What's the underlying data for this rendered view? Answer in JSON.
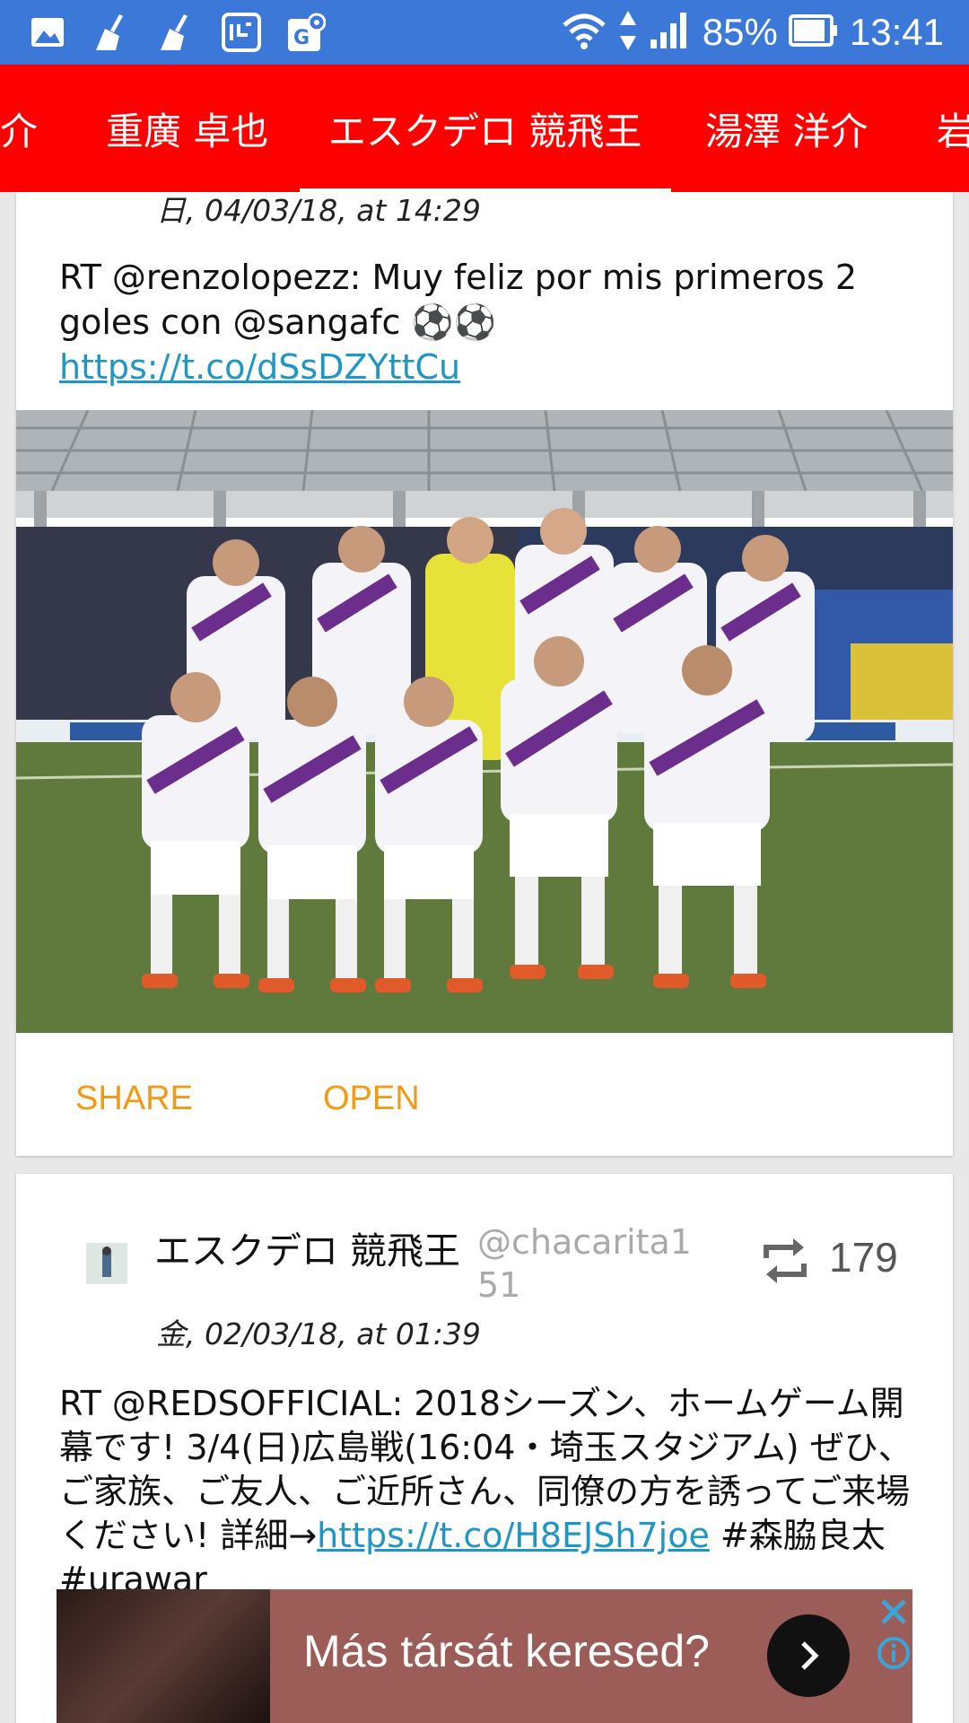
{
  "status_bar": {
    "battery": "85%",
    "time": "13:41",
    "left_icons": [
      "image-icon",
      "broom-icon",
      "broom-icon",
      "app-icon",
      "maps-icon"
    ],
    "right_icons": [
      "wifi-icon",
      "data-transfer-icon",
      "signal-icon",
      "battery-icon"
    ]
  },
  "tabs": [
    {
      "label": "介"
    },
    {
      "label": "重廣 卓也"
    },
    {
      "label": "エスクデロ 競飛王"
    },
    {
      "label": "湯澤 洋介"
    },
    {
      "label": "岩"
    }
  ],
  "colors": {
    "status_bar": "#3c78d8",
    "tab_bar": "#ff0000",
    "link": "#2196c4",
    "action": "#f29a13",
    "ad_bg": "#9c5d59"
  },
  "card1": {
    "date": "日, 04/03/18, at 14:29",
    "tweet_text": "RT @renzolopezz: Muy feliz por mis primeros 2 goles con @sangafc ⚽⚽",
    "tweet_link": "https://t.co/dSsDZYttCu",
    "share_label": "SHARE",
    "open_label": "OPEN"
  },
  "card2": {
    "author": "エスクデロ 競飛王",
    "handle": "@chacarita151",
    "retweet_count": "179",
    "date": "金, 02/03/18, at 01:39",
    "tweet_text": "RT @REDSOFFICIAL: 2018シーズン、ホームゲーム開幕です! 3/4(日)広島戦(16:04・埼玉スタジアム) ぜひ、ご家族、ご友人、ご近所さん、同僚の方を誘ってご来場ください! 詳細→",
    "tweet_link": "https://t.co/H8EJSh7joe",
    "tweet_tail": " #森脇良太 #urawar"
  },
  "ad": {
    "text": "Más társát keresed?"
  }
}
